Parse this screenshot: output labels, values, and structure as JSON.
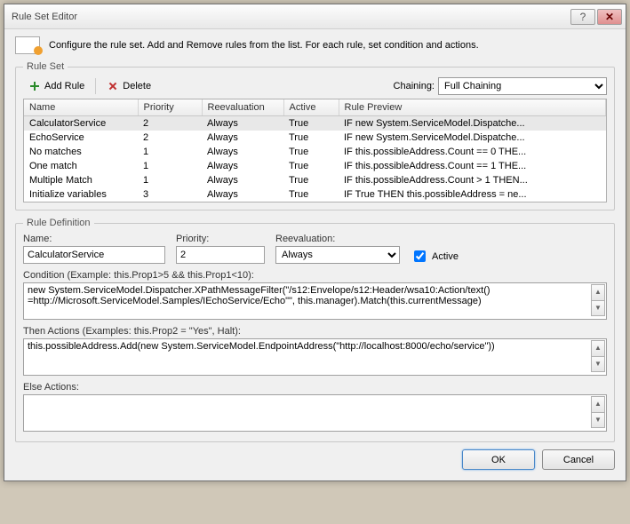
{
  "window": {
    "title": "Rule Set Editor"
  },
  "intro": "Configure the rule set. Add and Remove rules from the list. For each rule, set condition and actions.",
  "ruleset": {
    "legend": "Rule Set",
    "addLabel": "Add Rule",
    "deleteLabel": "Delete",
    "chainingLabel": "Chaining:",
    "chainingValue": "Full Chaining",
    "columns": {
      "name": "Name",
      "priority": "Priority",
      "reeval": "Reevaluation",
      "active": "Active",
      "preview": "Rule Preview"
    },
    "rows": [
      {
        "name": "CalculatorService",
        "priority": "2",
        "reeval": "Always",
        "active": "True",
        "preview": "IF new System.ServiceModel.Dispatche...",
        "selected": true
      },
      {
        "name": "EchoService",
        "priority": "2",
        "reeval": "Always",
        "active": "True",
        "preview": "IF new System.ServiceModel.Dispatche..."
      },
      {
        "name": "No matches",
        "priority": "1",
        "reeval": "Always",
        "active": "True",
        "preview": "IF this.possibleAddress.Count == 0 THE..."
      },
      {
        "name": "One match",
        "priority": "1",
        "reeval": "Always",
        "active": "True",
        "preview": "IF this.possibleAddress.Count == 1 THE..."
      },
      {
        "name": "Multiple Match",
        "priority": "1",
        "reeval": "Always",
        "active": "True",
        "preview": "IF this.possibleAddress.Count > 1 THEN..."
      },
      {
        "name": "Initialize variables",
        "priority": "3",
        "reeval": "Always",
        "active": "True",
        "preview": "IF True THEN this.possibleAddress = ne..."
      }
    ]
  },
  "def": {
    "legend": "Rule Definition",
    "nameLabel": "Name:",
    "nameValue": "CalculatorService",
    "priorityLabel": "Priority:",
    "priorityValue": "2",
    "reevalLabel": "Reevaluation:",
    "reevalValue": "Always",
    "activeLabel": "Active",
    "activeChecked": true,
    "conditionLabel": "Condition (Example: this.Prop1>5 && this.Prop1<10):",
    "conditionValue": "new System.ServiceModel.Dispatcher.XPathMessageFilter(\"/s12:Envelope/s12:Header/wsa10:Action/text()\n=http://Microsoft.ServiceModel.Samples/IEchoService/Echo\"\", this.manager).Match(this.currentMessage)",
    "thenLabel": "Then Actions (Examples: this.Prop2 = \"Yes\", Halt):",
    "thenValue": "this.possibleAddress.Add(new System.ServiceModel.EndpointAddress(\"http://localhost:8000/echo/service\"))",
    "elseLabel": "Else Actions:",
    "elseValue": ""
  },
  "buttons": {
    "ok": "OK",
    "cancel": "Cancel"
  }
}
